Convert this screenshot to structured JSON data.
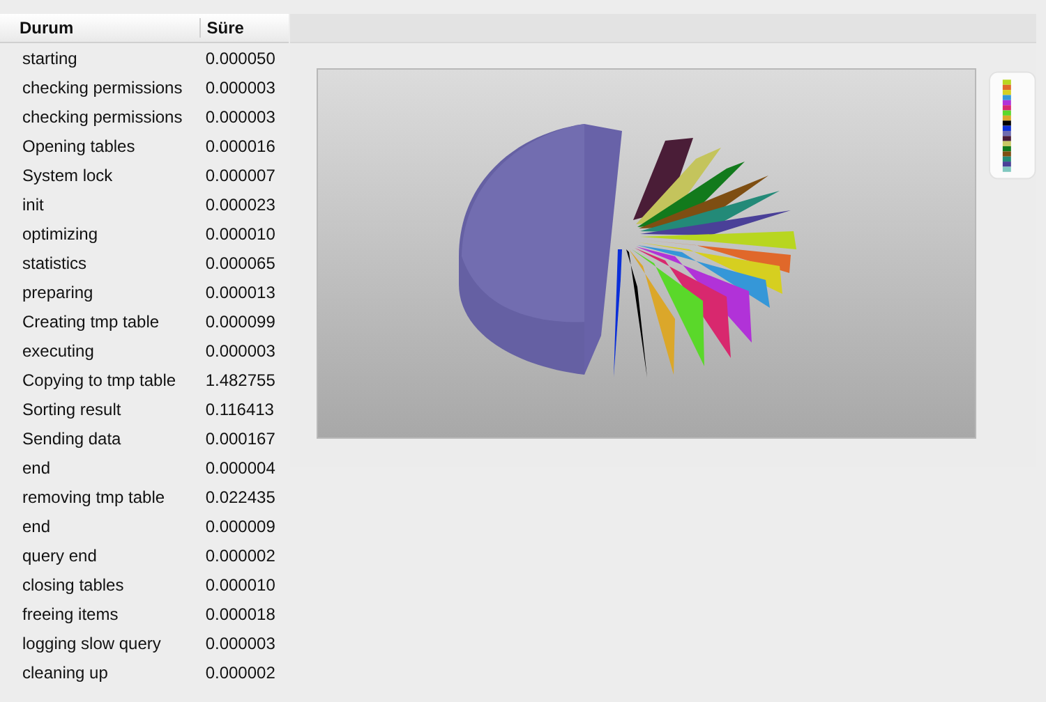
{
  "table": {
    "columns": [
      "Durum",
      "Süre"
    ],
    "rows": [
      [
        "starting",
        "0.000050"
      ],
      [
        "checking permissions",
        "0.000003"
      ],
      [
        "checking permissions",
        "0.000003"
      ],
      [
        "Opening tables",
        "0.000016"
      ],
      [
        "System lock",
        "0.000007"
      ],
      [
        "init",
        "0.000023"
      ],
      [
        "optimizing",
        "0.000010"
      ],
      [
        "statistics",
        "0.000065"
      ],
      [
        "preparing",
        "0.000013"
      ],
      [
        "Creating tmp table",
        "0.000099"
      ],
      [
        "executing",
        "0.000003"
      ],
      [
        "Copying to tmp table",
        "1.482755"
      ],
      [
        "Sorting result",
        "0.116413"
      ],
      [
        "Sending data",
        "0.000167"
      ],
      [
        "end",
        "0.000004"
      ],
      [
        "removing tmp table",
        "0.022435"
      ],
      [
        "end",
        "0.000009"
      ],
      [
        "query end",
        "0.000002"
      ],
      [
        "closing tables",
        "0.000010"
      ],
      [
        "freeing items",
        "0.000018"
      ],
      [
        "logging slow query",
        "0.000003"
      ],
      [
        "cleaning up",
        "0.000002"
      ]
    ]
  }
}
